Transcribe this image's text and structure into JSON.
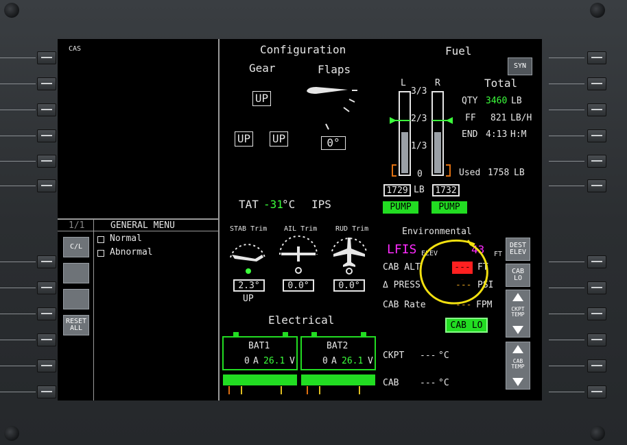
{
  "cas": {
    "label": "CAS"
  },
  "general_menu": {
    "page": "1/1",
    "title": "GENERAL MENU",
    "items": [
      "Normal",
      "Abnormal"
    ],
    "buttons": [
      "C/L",
      "",
      "",
      "RESET ALL"
    ]
  },
  "configuration": {
    "title": "Configuration",
    "gear_label": "Gear",
    "flaps_label": "Flaps",
    "gear_nose": "UP",
    "gear_left": "UP",
    "gear_right": "UP",
    "flaps_value": "0°"
  },
  "fuel": {
    "title": "Fuel",
    "syn_button": "SYN",
    "left_label": "L",
    "right_label": "R",
    "scale": [
      "3/3",
      "2/3",
      "1/3",
      "0"
    ],
    "left_qty": "1729",
    "right_qty": "1732",
    "unit": "LB",
    "pump_left": "PUMP",
    "pump_right": "PUMP",
    "left_fill_fraction": 0.52,
    "right_fill_fraction": 0.52,
    "total_label": "Total",
    "qty_label": "QTY",
    "qty_value": "3460",
    "qty_unit": "LB",
    "ff_label": "FF",
    "ff_value": "821",
    "ff_unit": "LB/H",
    "end_label": "END",
    "end_value": "4:13",
    "end_unit": "H:M",
    "used_label": "Used",
    "used_value": "1758",
    "used_unit": "LB"
  },
  "tat": {
    "label": "TAT",
    "value": "-31",
    "unit": "°C"
  },
  "ips": {
    "label": "IPS"
  },
  "trim": {
    "stab_label": "STAB Trim",
    "ail_label": "AIL Trim",
    "rud_label": "RUD Trim",
    "stab_value": "2.3°",
    "stab_dir": "UP",
    "ail_value": "0.0°",
    "rud_value": "0.0°"
  },
  "electrical": {
    "title": "Electrical",
    "bat1": {
      "name": "BAT1",
      "amps": "0",
      "amp_unit": "A",
      "volts": "26.1",
      "volt_unit": "V"
    },
    "bat2": {
      "name": "BAT2",
      "amps": "0",
      "amp_unit": "A",
      "volts": "26.1",
      "volt_unit": "V"
    }
  },
  "environmental": {
    "title": "Environmental",
    "dest_code": "LFIS",
    "elev_label": "ELEV",
    "elev_value": "43",
    "elev_unit": "FT",
    "cab_alt_label": "CAB ALT",
    "cab_alt_value": "----",
    "cab_alt_unit": "FT",
    "dpress_label": "Δ PRESS",
    "dpress_value": "---",
    "dpress_unit": "PSI",
    "cab_rate_label": "CAB Rate",
    "cab_rate_value": "---",
    "cab_rate_unit": "FPM",
    "cab_lo_badge": "CAB LO",
    "ckpt_label": "CKPT",
    "ckpt_value": "---",
    "ckpt_unit": "°C",
    "cab_label": "CAB",
    "cab_value": "---",
    "cab_unit": "°C",
    "dest_elev_button": "DEST ELEV",
    "cab_lo_button": "CAB LO",
    "ckpt_temp_button": "CKPT TEMP",
    "cab_temp_button": "CAB TEMP"
  },
  "colors": {
    "green": "#3cff3c",
    "magenta": "#ff2bff",
    "amber": "#e0a020",
    "red": "#ff2020",
    "annotation": "#f2e010"
  }
}
